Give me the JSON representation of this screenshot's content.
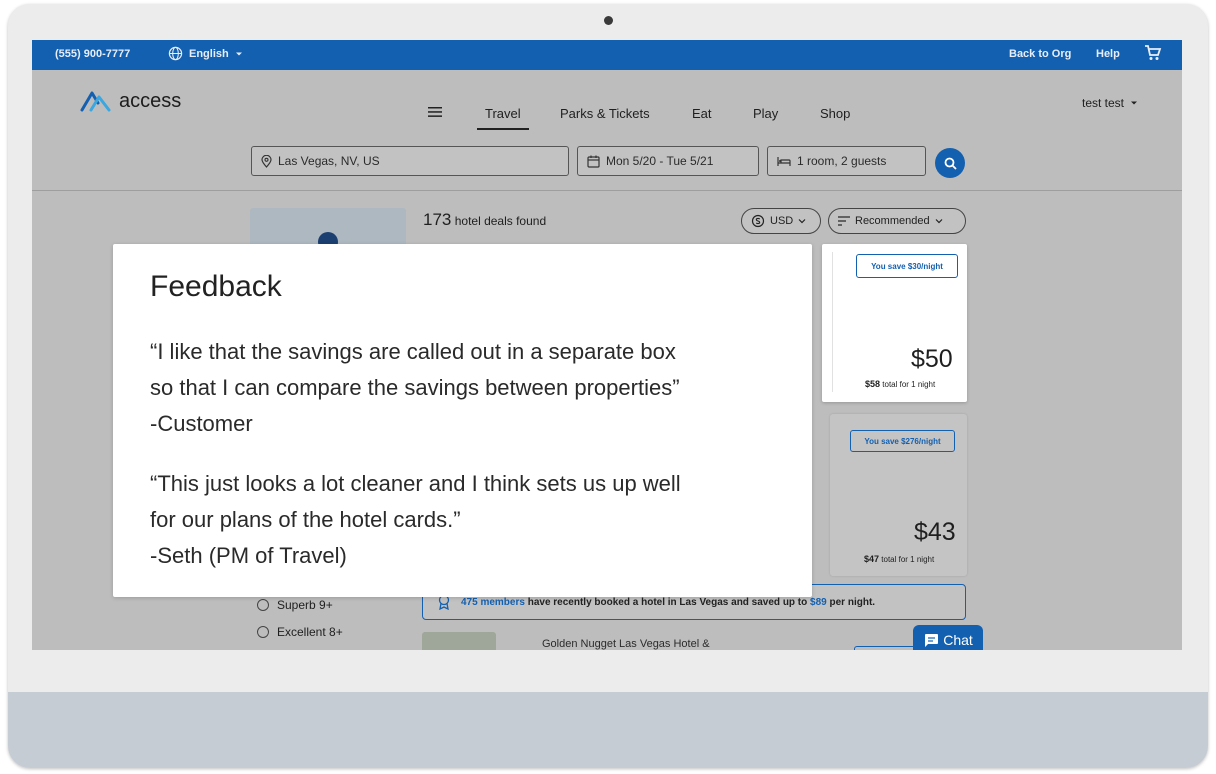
{
  "topbar": {
    "phone": "(555) 900-7777",
    "language": "English",
    "back_to_org": "Back to Org",
    "help": "Help"
  },
  "header": {
    "logo": "access",
    "nav": [
      "Travel",
      "Parks & Tickets",
      "Eat",
      "Play",
      "Shop"
    ],
    "active_nav": "Travel",
    "user": "test test"
  },
  "search": {
    "location": "Las Vegas, NV, US",
    "dates": "Mon 5/20 - Tue 5/21",
    "guests": "1 room, 2 guests"
  },
  "results": {
    "count": "173",
    "count_label": "hotel deals found",
    "currency": "USD",
    "sort": "Recommended"
  },
  "cards": [
    {
      "savings": "You save $30/night",
      "price": "$50",
      "total": "$58",
      "total_label": "total for 1 night"
    },
    {
      "savings": "You save $276/night",
      "price": "$43",
      "total": "$47",
      "total_label": "total for 1 night"
    }
  ],
  "members_banner": {
    "members": "475 members",
    "text": "have recently booked a hotel in Las Vegas and saved up to",
    "amount": "$89",
    "suffix": "per night."
  },
  "filters": {
    "ratings": [
      "Superb 9+",
      "Excellent 8+"
    ]
  },
  "bottom_listing": {
    "title": "Golden Nugget Las Vegas Hotel &"
  },
  "chat": {
    "label": "Chat"
  },
  "feedback": {
    "title": "Feedback",
    "quote1": [
      "“I like that the savings are called out in a separate box",
      "so that I can compare the savings between properties”",
      "-Customer"
    ],
    "quote2": [
      "“This just looks a lot cleaner and I think sets us up well",
      "for our plans of the hotel cards.”",
      "-Seth (PM of Travel)"
    ]
  },
  "colors": {
    "brand_blue": "#1460b0",
    "overlay_gray": "#bdbdbd",
    "panel": "#ffffff"
  }
}
